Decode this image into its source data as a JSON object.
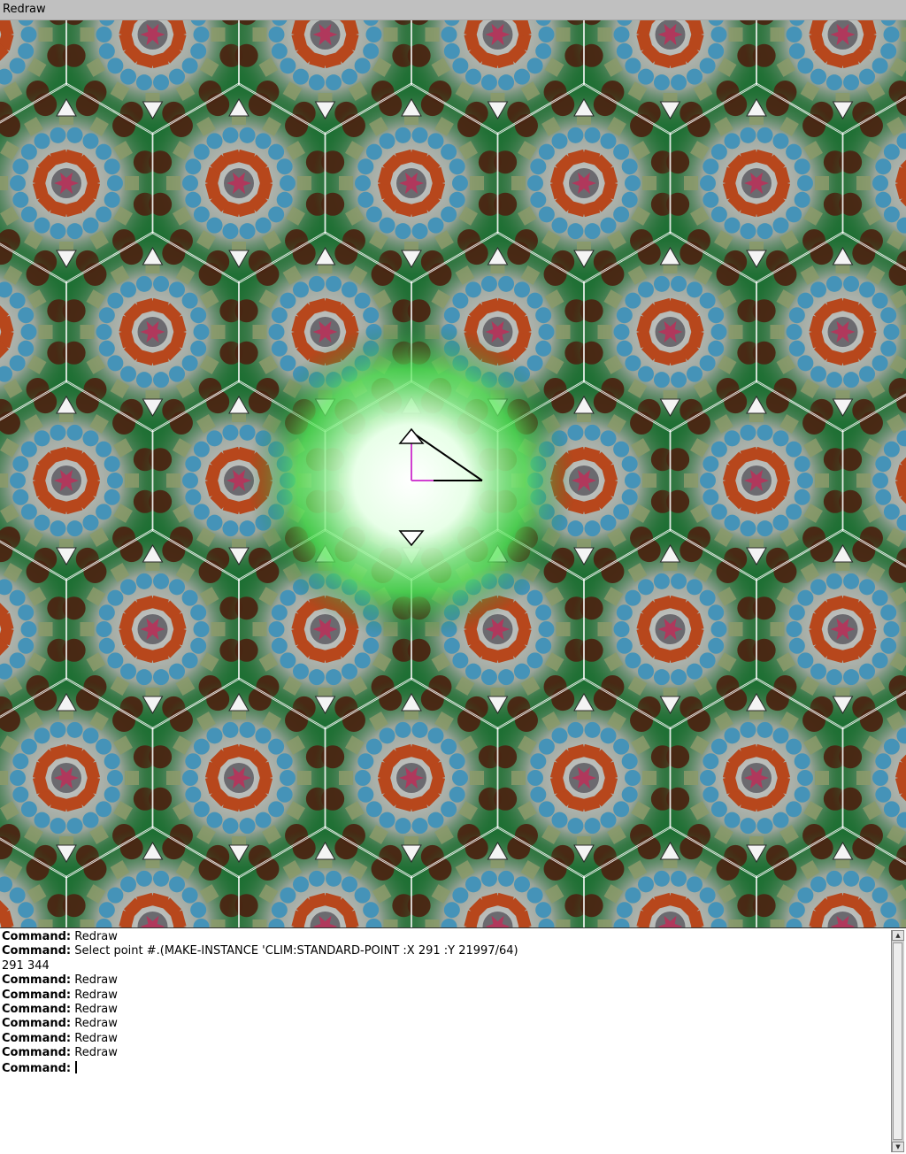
{
  "menubar": {
    "redraw_label": "Redraw"
  },
  "canvas": {
    "description_icon": "hexagonal-tiling-pattern",
    "colors": {
      "background": "#1d6f33",
      "green_dark": "#1e6b2c",
      "green_mid": "#3f9b45",
      "grey": "#9aa49a",
      "brown": "#4a2512",
      "blue": "#4593b8",
      "rust": "#b7471c",
      "khaki": "#8c9a6a",
      "lines": "#ffffff",
      "highlight": "#7dff7d"
    }
  },
  "console": {
    "lines": [
      {
        "prompt": "Command:",
        "text": " Redraw"
      },
      {
        "prompt": "Command:",
        "text": " Select point #.(MAKE-INSTANCE 'CLIM:STANDARD-POINT :X 291 :Y 21997/64)"
      },
      {
        "prompt": "",
        "text": "291 344"
      },
      {
        "prompt": "Command:",
        "text": " Redraw"
      },
      {
        "prompt": "Command:",
        "text": " Redraw"
      },
      {
        "prompt": "Command:",
        "text": " Redraw"
      },
      {
        "prompt": "Command:",
        "text": " Redraw"
      },
      {
        "prompt": "Command:",
        "text": " Redraw"
      },
      {
        "prompt": "Command:",
        "text": " Redraw"
      }
    ],
    "current_prompt": "Command:"
  }
}
